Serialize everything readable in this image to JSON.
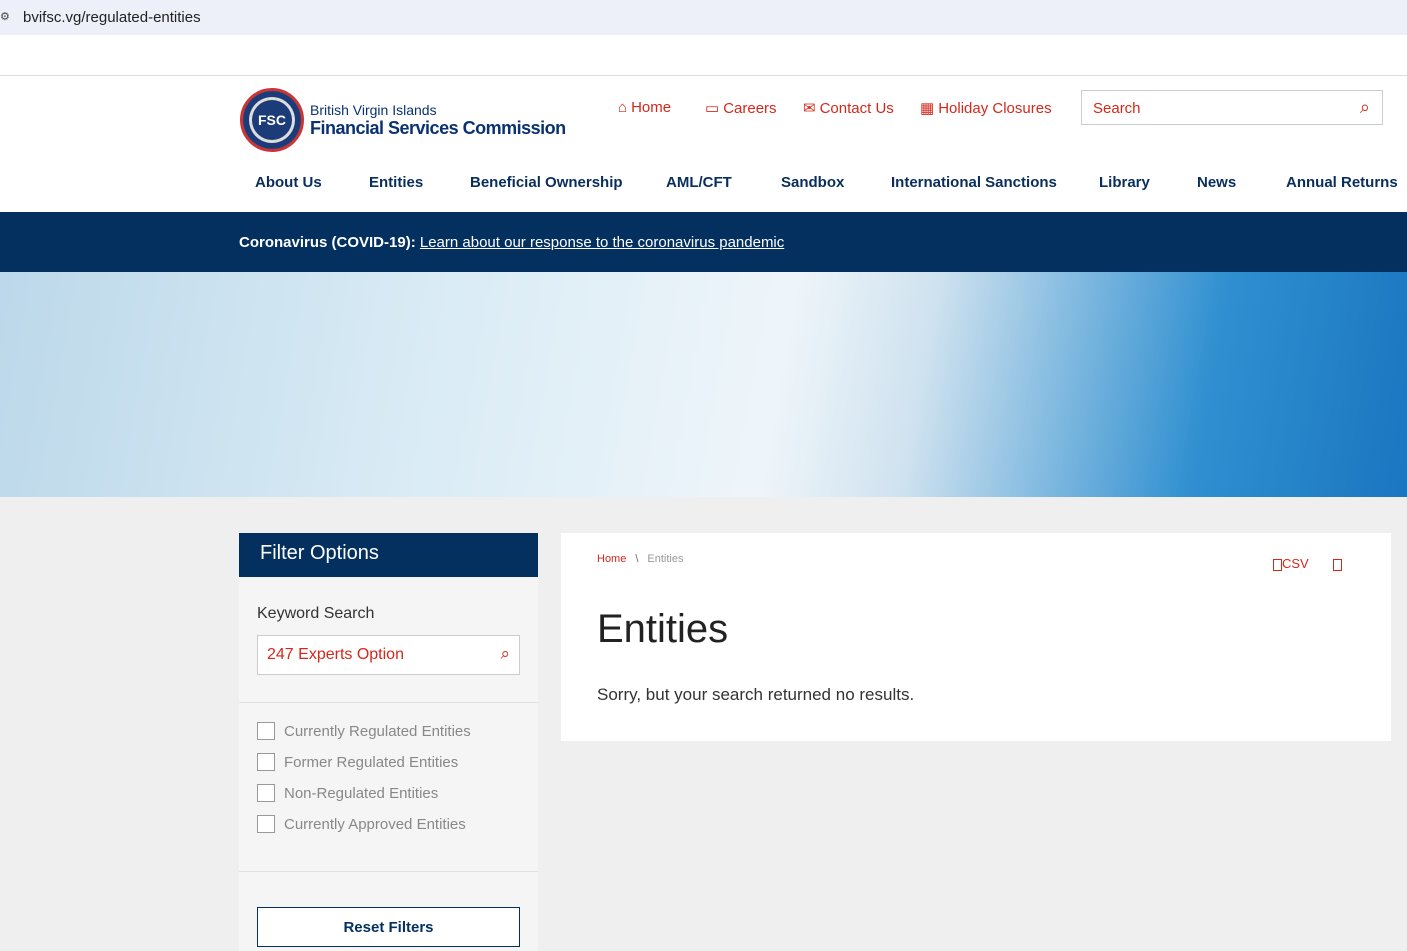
{
  "url": "bvifsc.vg/regulated-entities",
  "logo": {
    "line1": "British Virgin Islands",
    "line2": "Financial Services Commission",
    "seal": "FSC"
  },
  "utility": [
    {
      "label": "Home",
      "icon": "home-icon"
    },
    {
      "label": "Careers",
      "icon": "briefcase-icon"
    },
    {
      "label": "Contact Us",
      "icon": "envelope-icon"
    },
    {
      "label": "Holiday Closures",
      "icon": "calendar-icon"
    }
  ],
  "search": {
    "placeholder": "Search"
  },
  "nav": [
    "About Us",
    "Entities",
    "Beneficial Ownership",
    "AML/CFT",
    "Sandbox",
    "International Sanctions",
    "Library",
    "News",
    "Annual Returns"
  ],
  "banner": {
    "bold": "Coronavirus (COVID-19):",
    "link": "Learn about our response to the coronavirus pandemic"
  },
  "filter": {
    "title": "Filter Options",
    "keyword_label": "Keyword Search",
    "keyword_value": "247 Experts Option",
    "options": [
      "Currently Regulated Entities",
      "Former Regulated Entities",
      "Non-Regulated Entities",
      "Currently Approved Entities"
    ],
    "reset": "Reset Filters"
  },
  "main": {
    "breadcrumb": [
      "Home",
      "Entities"
    ],
    "csv": "CSV",
    "title": "Entities",
    "message": "Sorry, but your search returned no results."
  },
  "colors": {
    "accent": "#d4281c",
    "navy": "#03305f"
  }
}
